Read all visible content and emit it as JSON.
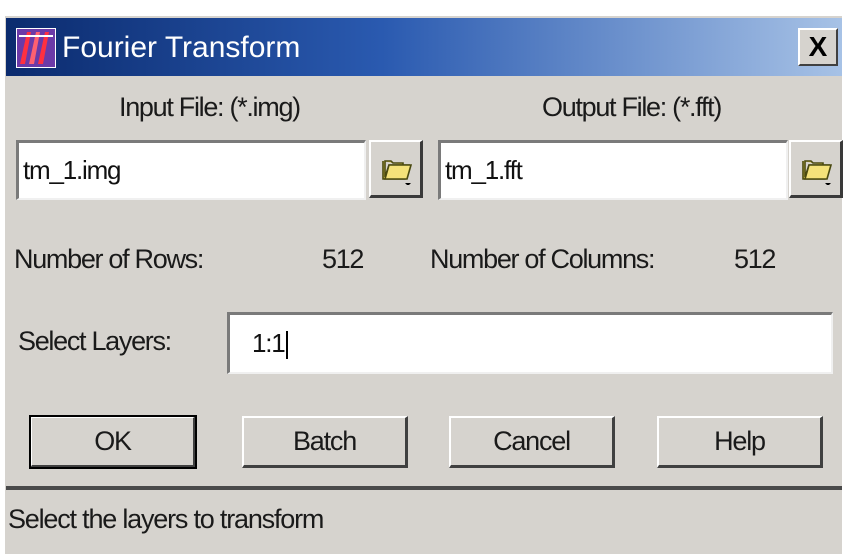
{
  "window": {
    "title": "Fourier Transform",
    "close_label": "X",
    "colors": {
      "titlebar_start": "#0b2b6e",
      "titlebar_end": "#a7c2e6",
      "dialog_bg": "#d6d3ce"
    }
  },
  "input_file": {
    "label": "Input File: (*.img)",
    "value": "tm_1.img",
    "browse_icon": "open-folder-icon"
  },
  "output_file": {
    "label": "Output File: (*.fft)",
    "value": "tm_1.fft",
    "browse_icon": "open-folder-icon"
  },
  "dimensions": {
    "rows_label": "Number of Rows:",
    "rows_value": "512",
    "columns_label": "Number of Columns:",
    "columns_value": "512"
  },
  "layers": {
    "label": "Select Layers:",
    "value": "1:1"
  },
  "buttons": {
    "ok": "OK",
    "batch": "Batch",
    "cancel": "Cancel",
    "help": "Help"
  },
  "status": {
    "text": "Select the layers to transform"
  }
}
